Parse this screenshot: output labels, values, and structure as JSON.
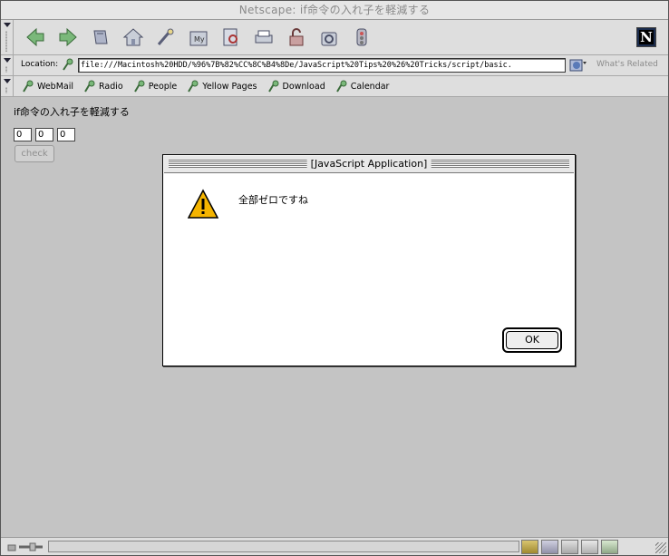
{
  "window": {
    "title": "Netscape: if命令の入れ子を軽減する"
  },
  "toolbar": {
    "buttons": [
      "back-icon",
      "forward-icon",
      "reload-icon",
      "home-icon",
      "search-icon",
      "my-netscape-icon",
      "images-icon",
      "print-icon",
      "security-icon",
      "shop-icon",
      "stop-icon"
    ],
    "logo": "N"
  },
  "location": {
    "label": "Location:",
    "url": "file:///Macintosh%20HDD/%96%7B%82%CC%8C%B4%8De/JavaScript%20Tips%20%26%20Tricks/script/basic.",
    "related": "What's Related"
  },
  "personal": {
    "items": [
      {
        "label": "WebMail"
      },
      {
        "label": "Radio"
      },
      {
        "label": "People"
      },
      {
        "label": "Yellow Pages"
      },
      {
        "label": "Download"
      },
      {
        "label": "Calendar"
      }
    ]
  },
  "page": {
    "heading": "if命令の入れ子を軽減する",
    "fields": [
      "0",
      "0",
      "0"
    ],
    "check_label": "check"
  },
  "dialog": {
    "title": "[JavaScript Application]",
    "message": "全部ゼロですね",
    "ok_label": "OK"
  }
}
